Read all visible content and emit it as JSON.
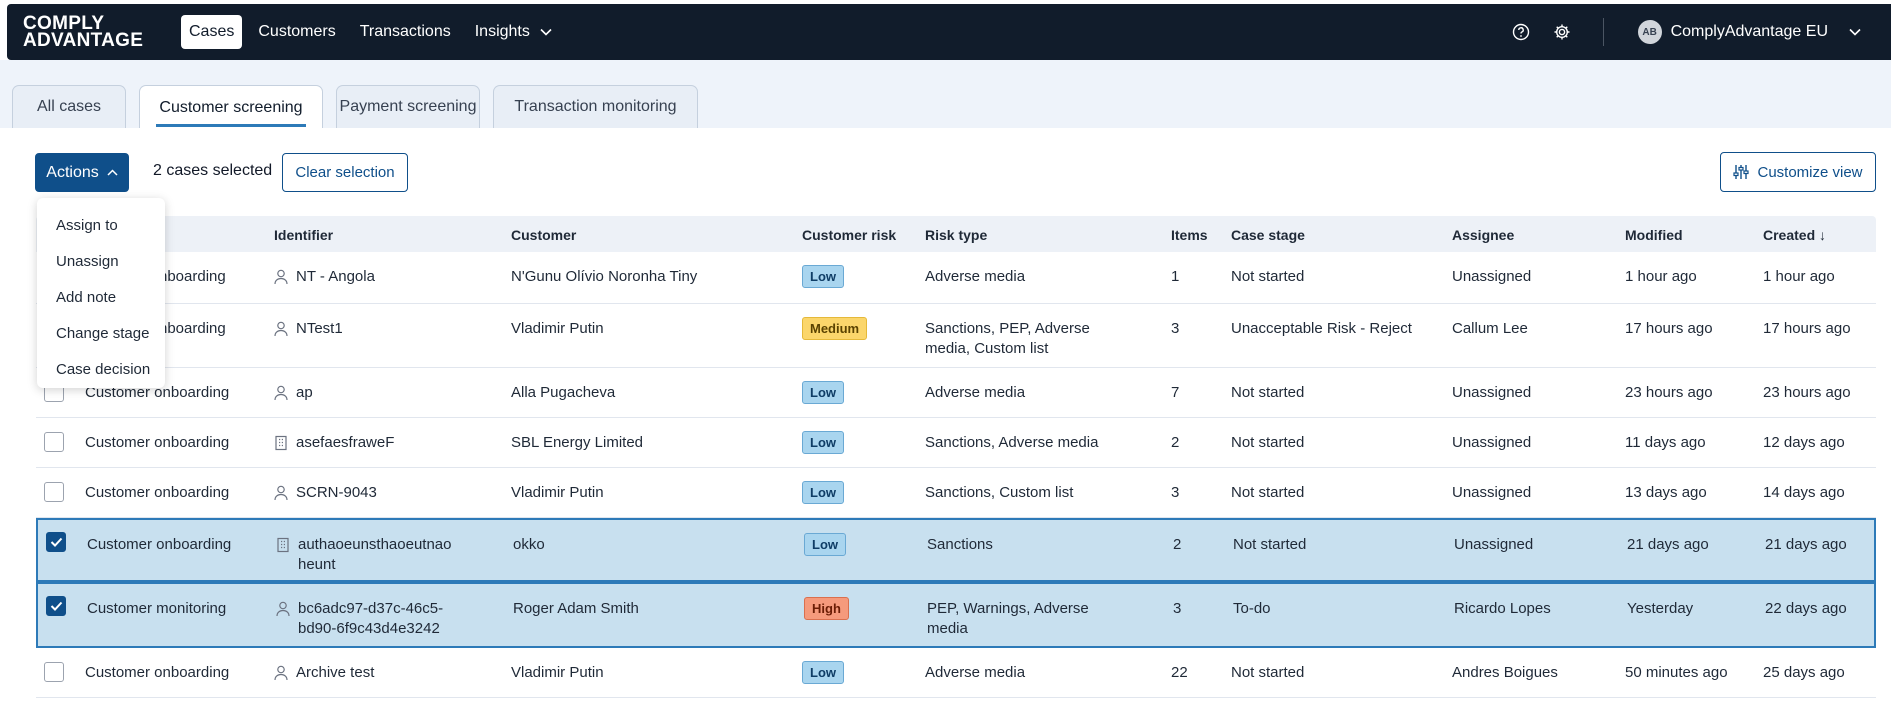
{
  "logo": {
    "line1": "COMPLY",
    "line2": "ADVANTAGE"
  },
  "nav": [
    {
      "label": "Cases",
      "active": true
    },
    {
      "label": "Customers",
      "active": false
    },
    {
      "label": "Transactions",
      "active": false
    },
    {
      "label": "Insights",
      "active": false,
      "dropdown": true
    }
  ],
  "account": {
    "initials": "AB",
    "name": "ComplyAdvantage EU"
  },
  "tabs": [
    "All cases",
    "Customer screening",
    "Payment screening",
    "Transaction monitoring"
  ],
  "toolbar": {
    "actions_label": "Actions",
    "selected_text": "2 cases selected",
    "clear_label": "Clear selection",
    "customize_label": "Customize view"
  },
  "actions_menu": [
    "Assign to",
    "Unassign",
    "Add note",
    "Change stage",
    "Case decision"
  ],
  "table": {
    "headers": {
      "identifier": "Identifier",
      "customer": "Customer",
      "risk": "Customer risk",
      "risk_type": "Risk type",
      "items": "Items",
      "stage": "Case stage",
      "assignee": "Assignee",
      "modified": "Modified",
      "created": "Created ↓"
    },
    "rows": [
      {
        "type": "onboarding",
        "type_visible": "nboarding",
        "identifier": "NT - Angola",
        "id_icon": "person",
        "customer": "N'Gunu Olívio Noronha Tiny",
        "risk": "Low",
        "risk_type": "Adverse media",
        "items": "1",
        "stage": "Not started",
        "assignee": "Unassigned",
        "modified": "1 hour ago",
        "created": "1 hour ago",
        "checked": false
      },
      {
        "type": "onboarding",
        "type_visible": "nboarding",
        "identifier": "NTest1",
        "id_icon": "person",
        "customer": "Vladimir Putin",
        "risk": "Medium",
        "risk_type_lines": [
          "Sanctions, PEP, Adverse",
          "media, Custom list"
        ],
        "items": "3",
        "stage": "Unacceptable Risk - Reject",
        "assignee": "Callum Lee",
        "modified": "17 hours ago",
        "created": "17 hours ago",
        "checked": false
      },
      {
        "type": "Customer onboarding",
        "identifier": "ap",
        "id_icon": "person",
        "customer": "Alla Pugacheva",
        "risk": "Low",
        "risk_type": "Adverse media",
        "items": "7",
        "stage": "Not started",
        "assignee": "Unassigned",
        "modified": "23 hours ago",
        "created": "23 hours ago",
        "checked": false
      },
      {
        "type": "Customer onboarding",
        "identifier": "asefaesfraweF",
        "id_icon": "building",
        "customer": "SBL Energy Limited",
        "risk": "Low",
        "risk_type": "Sanctions, Adverse media",
        "items": "2",
        "stage": "Not started",
        "assignee": "Unassigned",
        "modified": "11 days ago",
        "created": "12 days ago",
        "checked": false
      },
      {
        "type": "Customer onboarding",
        "identifier": "SCRN-9043",
        "id_icon": "person",
        "customer": "Vladimir Putin",
        "risk": "Low",
        "risk_type": "Sanctions, Custom list",
        "items": "3",
        "stage": "Not started",
        "assignee": "Unassigned",
        "modified": "13 days ago",
        "created": "14 days ago",
        "checked": false
      },
      {
        "type": "Customer onboarding",
        "identifier_lines": [
          "authaoeunsthaoeutnao",
          "heunt"
        ],
        "id_icon": "building",
        "customer": "okko",
        "risk": "Low",
        "risk_type": "Sanctions",
        "items": "2",
        "stage": "Not started",
        "assignee": "Unassigned",
        "modified": "21 days ago",
        "created": "21 days ago",
        "checked": true
      },
      {
        "type": "Customer monitoring",
        "identifier_lines": [
          "bc6adc97-d37c-46c5-",
          "bd90-6f9c43d4e3242"
        ],
        "id_icon": "person",
        "customer": "Roger Adam Smith",
        "risk": "High",
        "risk_type_lines": [
          "PEP, Warnings, Adverse",
          "media"
        ],
        "items": "3",
        "stage": "To-do",
        "assignee": "Ricardo Lopes",
        "modified": "Yesterday",
        "created": "22 days ago",
        "checked": true
      },
      {
        "type": "Customer onboarding",
        "identifier": "Archive test",
        "id_icon": "person",
        "customer": "Vladimir Putin",
        "risk": "Low",
        "risk_type": "Adverse media",
        "items": "22",
        "stage": "Not started",
        "assignee": "Andres Boigues",
        "modified": "50 minutes ago",
        "created": "25 days ago",
        "checked": false
      }
    ]
  },
  "colors": {
    "navy": "#111c2b",
    "primary": "#0f4f8a",
    "selected_row": "#c8e0ef",
    "low": "#a9d5ef",
    "medium": "#fbd66b",
    "high": "#f59a7c"
  }
}
